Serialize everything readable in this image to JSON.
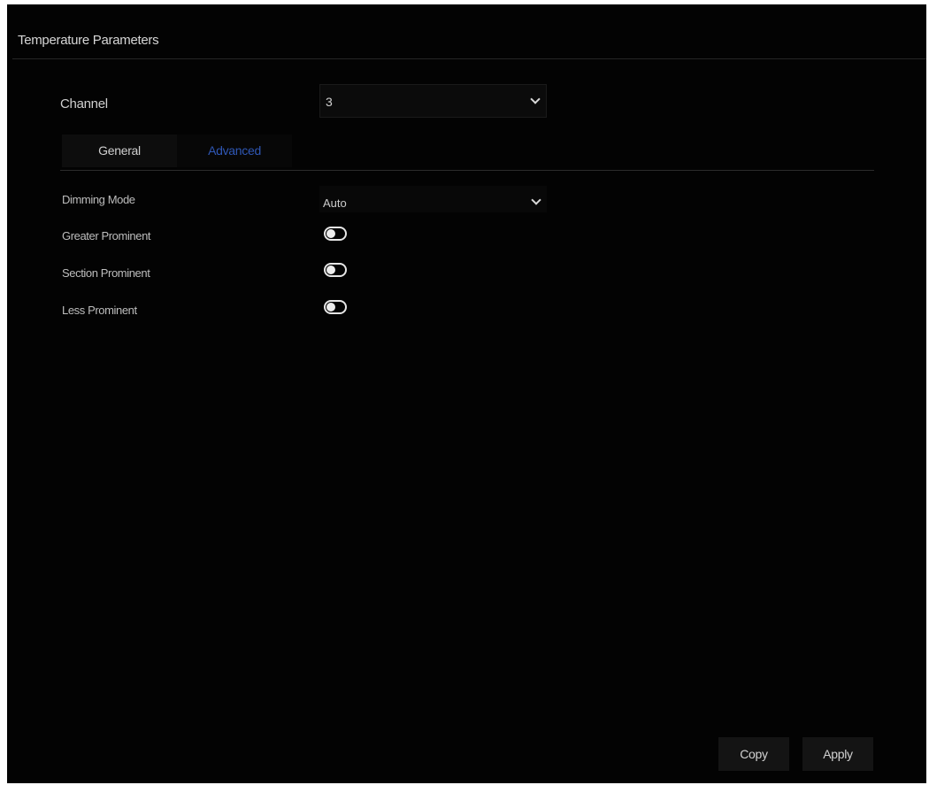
{
  "page": {
    "title": "Temperature Parameters"
  },
  "channel": {
    "label": "Channel",
    "value": "3"
  },
  "tabs": [
    {
      "label": "General",
      "active": false
    },
    {
      "label": "Advanced",
      "active": true
    }
  ],
  "form": {
    "dimming_mode": {
      "label": "Dimming Mode",
      "value": "Auto"
    },
    "toggles": [
      {
        "label": "Greater Prominent",
        "enabled": false
      },
      {
        "label": "Section Prominent",
        "enabled": false
      },
      {
        "label": "Less Prominent",
        "enabled": false
      }
    ]
  },
  "buttons": {
    "copy": "Copy",
    "apply": "Apply"
  },
  "colors": {
    "background": "#030303",
    "text": "#d9d9d9",
    "active_tab": "#2f57b5"
  },
  "icons": {
    "dropdown": "chevron-down-icon"
  }
}
